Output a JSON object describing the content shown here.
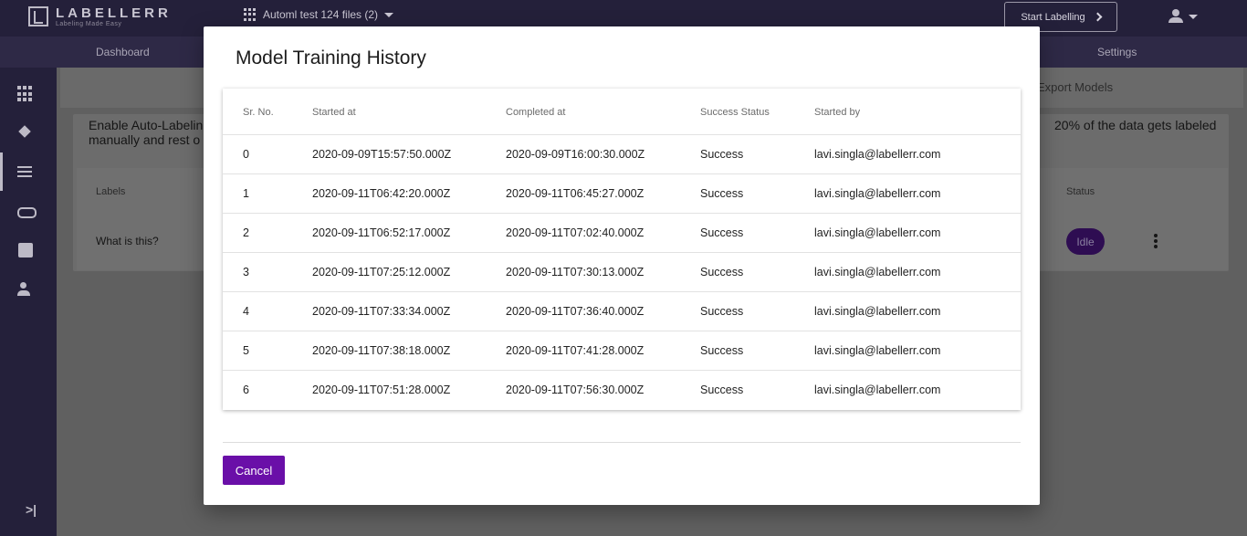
{
  "app": {
    "logo_text": "LABELLERR",
    "logo_tagline": "Labeling Made Easy",
    "project_name": "Automl test 124 files (2)",
    "start_labelling": "Start Labelling"
  },
  "nav": {
    "dashboard": "Dashboard",
    "settings": "Settings"
  },
  "sidebar": {
    "items": [
      "apps-icon",
      "layers-icon",
      "tune-icon",
      "link-icon",
      "badge-icon",
      "manage-accounts-icon"
    ],
    "collapse_glyph": ">|"
  },
  "main": {
    "export_models": "Export Models",
    "info_left": "Enable Auto-Labelin manually and rest o",
    "info_right": "20% of the data gets labeled",
    "labels_header": "Labels",
    "status_header": "Status",
    "label_value": "What is this?",
    "status_value": "Idle"
  },
  "modal": {
    "title": "Model Training History",
    "columns": [
      "Sr. No.",
      "Started at",
      "Completed at",
      "Success Status",
      "Started by"
    ],
    "rows": [
      [
        "0",
        "2020-09-09T15:57:50.000Z",
        "2020-09-09T16:00:30.000Z",
        "Success",
        "lavi.singla@labellerr.com"
      ],
      [
        "1",
        "2020-09-11T06:42:20.000Z",
        "2020-09-11T06:45:27.000Z",
        "Success",
        "lavi.singla@labellerr.com"
      ],
      [
        "2",
        "2020-09-11T06:52:17.000Z",
        "2020-09-11T07:02:40.000Z",
        "Success",
        "lavi.singla@labellerr.com"
      ],
      [
        "3",
        "2020-09-11T07:25:12.000Z",
        "2020-09-11T07:30:13.000Z",
        "Success",
        "lavi.singla@labellerr.com"
      ],
      [
        "4",
        "2020-09-11T07:33:34.000Z",
        "2020-09-11T07:36:40.000Z",
        "Success",
        "lavi.singla@labellerr.com"
      ],
      [
        "5",
        "2020-09-11T07:38:18.000Z",
        "2020-09-11T07:41:28.000Z",
        "Success",
        "lavi.singla@labellerr.com"
      ],
      [
        "6",
        "2020-09-11T07:51:28.000Z",
        "2020-09-11T07:56:30.000Z",
        "Success",
        "lavi.singla@labellerr.com"
      ]
    ],
    "cancel_label": "Cancel"
  },
  "colors": {
    "brand_purple": "#6a0fa8",
    "topbar": "#24203a"
  }
}
